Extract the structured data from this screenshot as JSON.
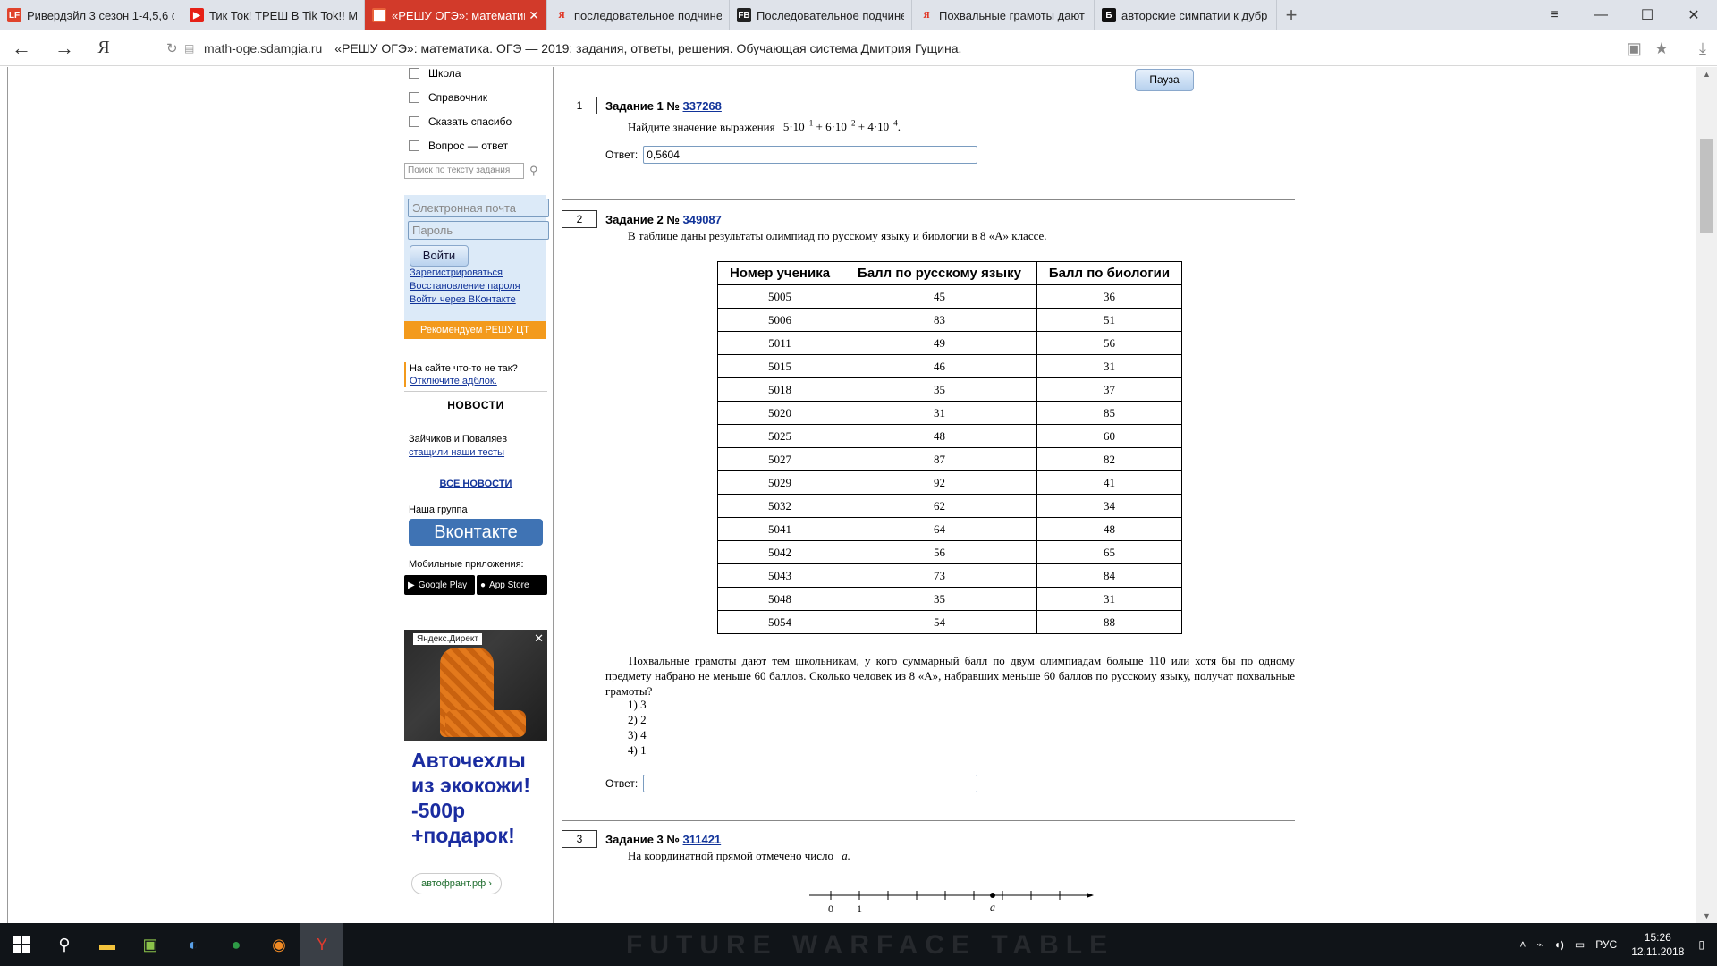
{
  "tabs": [
    {
      "label": "Ривердэйл 3 сезон 1-4,5,6 с",
      "icon": "LF",
      "active": false
    },
    {
      "label": "Тик Ток! ТРЕШ В Tik Tok!! М",
      "icon": "youtube-icon",
      "active": false
    },
    {
      "label": "«РЕШУ ОГЭ»: математик",
      "icon": "reshu-icon",
      "active": true
    },
    {
      "label": "последовательное подчине",
      "icon": "Я",
      "active": false
    },
    {
      "label": "Последовательное подчине",
      "icon": "FB",
      "active": false
    },
    {
      "label": "Похвальные грамоты дают",
      "icon": "Я",
      "active": false
    },
    {
      "label": "авторские симпатии к дубр",
      "icon": "Б",
      "active": false
    }
  ],
  "address": {
    "domain": "math-oge.sdamgia.ru",
    "title": "«РЕШУ ОГЭ»: математика. ОГЭ — 2019: задания, ответы, решения. Обучающая система Дмитрия Гущина."
  },
  "sidebar": {
    "menu": [
      "Школа",
      "Справочник",
      "Сказать спасибо",
      "Вопрос — ответ"
    ],
    "search_placeholder": "Поиск по тексту задания",
    "email_placeholder": "Электронная почта",
    "password_placeholder": "Пароль",
    "login_label": "Войти",
    "links": [
      "Зарегистрироваться",
      "Восстановление пароля",
      "Войти через ВКонтакте"
    ],
    "banner": "Рекомендуем РЕШУ ЦТ",
    "adblock_text": "На сайте что-то не так?",
    "adblock_link": "Отключите адблок.",
    "news_heading": "НОВОСТИ",
    "news_text": "Зайчиков и Поваляев",
    "news_link": "стащили наши тесты",
    "all_news": "ВСЕ НОВОСТИ",
    "group_label": "Наша группа",
    "vk_label": "Вконтакте",
    "apps_label": "Мобильные приложения:",
    "google_play": "Google Play",
    "app_store": "App Store",
    "ad_tag": "Яндекс.Директ",
    "ad_text": "Авточехлы из экокожи! -500р +подарок!",
    "ad_link": "автофрант.рф ›"
  },
  "pause_label": "Пауза",
  "task1": {
    "num": "1",
    "head": "Задание 1 №",
    "id": "337268",
    "text": "Найдите значение выражения",
    "answer_label": "Ответ:",
    "answer_value": "0,5604"
  },
  "task2": {
    "num": "2",
    "head": "Задание 2 №",
    "id": "349087",
    "text": "В таблице даны результаты олимпиад по русскому языку и биологии в 8 «А» классе.",
    "headers": [
      "Номер ученика",
      "Балл по русскому языку",
      "Балл по биологии"
    ],
    "rows": [
      [
        "5005",
        "45",
        "36"
      ],
      [
        "5006",
        "83",
        "51"
      ],
      [
        "5011",
        "49",
        "56"
      ],
      [
        "5015",
        "46",
        "31"
      ],
      [
        "5018",
        "35",
        "37"
      ],
      [
        "5020",
        "31",
        "85"
      ],
      [
        "5025",
        "48",
        "60"
      ],
      [
        "5027",
        "87",
        "82"
      ],
      [
        "5029",
        "92",
        "41"
      ],
      [
        "5032",
        "62",
        "34"
      ],
      [
        "5041",
        "64",
        "48"
      ],
      [
        "5042",
        "56",
        "65"
      ],
      [
        "5043",
        "73",
        "84"
      ],
      [
        "5048",
        "35",
        "31"
      ],
      [
        "5054",
        "54",
        "88"
      ]
    ],
    "paragraph": "Похвальные грамоты дают тем школьникам, у кого суммарный балл по двум олимпиадам больше 110 или хотя бы по одному предмету набрано не меньше 60 баллов. Сколько человек из 8 «А», набравших меньше 60 баллов по русскому языку, получат похвальные грамоты?",
    "options": [
      "1) 3",
      "2) 2",
      "3) 4",
      "4) 1"
    ],
    "answer_label": "Ответ:",
    "answer_value": ""
  },
  "task3": {
    "num": "3",
    "head": "Задание 3 №",
    "id": "311421",
    "text": "На координатной прямой отмечено число",
    "var": "a.",
    "tick0": "0",
    "tick1": "1",
    "point_label": "a"
  },
  "taskbar": {
    "lang": "РУС",
    "time": "15:26",
    "date": "12.11.2018",
    "watermark": "FUTURE   WARFACE   TABLE"
  }
}
